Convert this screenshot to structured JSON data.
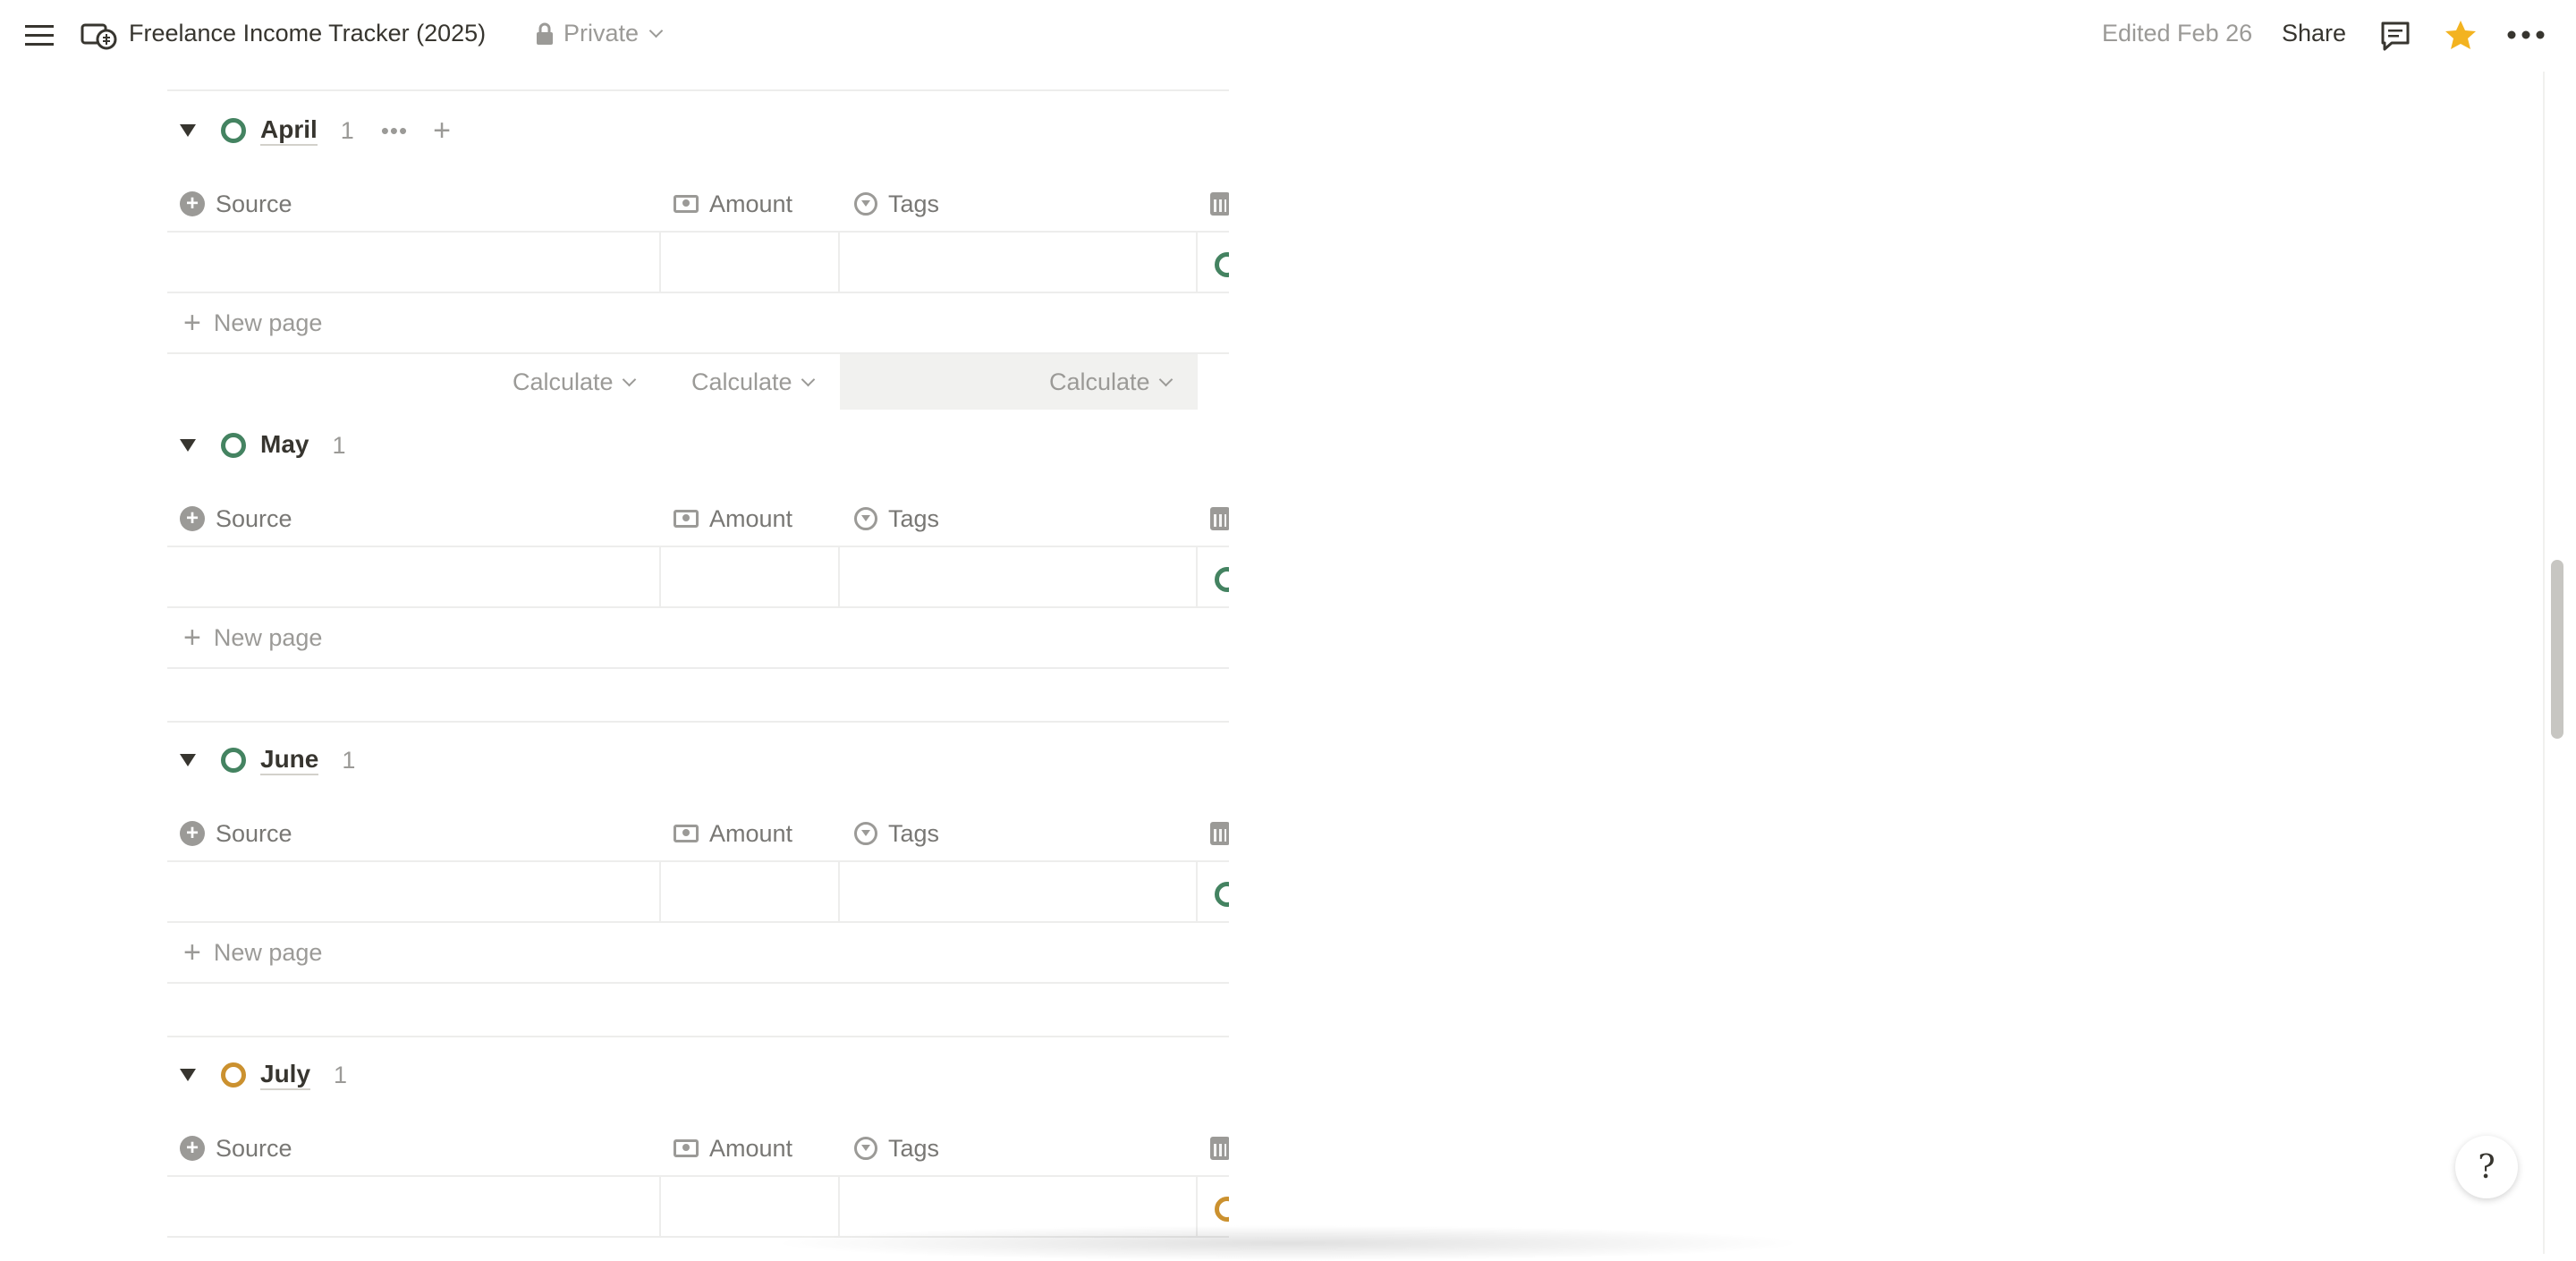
{
  "topbar": {
    "title": "Freelance Income Tracker (2025)",
    "visibility": "Private",
    "edited": "Edited Feb 26",
    "share": "Share"
  },
  "columns": {
    "source": "Source",
    "amount": "Amount",
    "tags": "Tags"
  },
  "new_page_label": "New page",
  "calculate_label": "Calculate",
  "groups": [
    {
      "name": "April",
      "count": "1",
      "status_color": "#448361"
    },
    {
      "name": "May",
      "count": "1",
      "status_color": "#448361"
    },
    {
      "name": "June",
      "count": "1",
      "status_color": "#448361"
    },
    {
      "name": "July",
      "count": "1",
      "status_color": "#cb912f"
    }
  ],
  "help_glyph": "?"
}
